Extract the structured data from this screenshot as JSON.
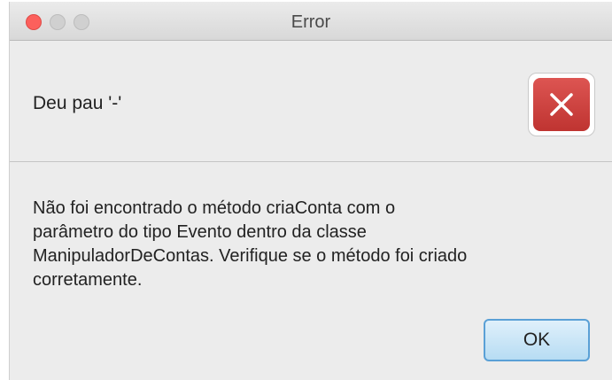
{
  "window": {
    "title": "Error",
    "controls": [
      "close",
      "minimize",
      "zoom"
    ]
  },
  "dialog": {
    "header_text": "Deu pau '-'",
    "icon": "error-x-icon",
    "content_lines": [
      "Não foi encontrado o método criaConta com o",
      "parâmetro do tipo Evento dentro da classe",
      "ManipuladorDeContas. Verifique se o método foi criado",
      "corretamente."
    ],
    "ok_label": "OK"
  },
  "colors": {
    "close_button": "#fc605c",
    "error_icon": "#c9403c",
    "ok_button_border": "#5aa0d6",
    "ok_button_fill": "#c9e5f7"
  }
}
